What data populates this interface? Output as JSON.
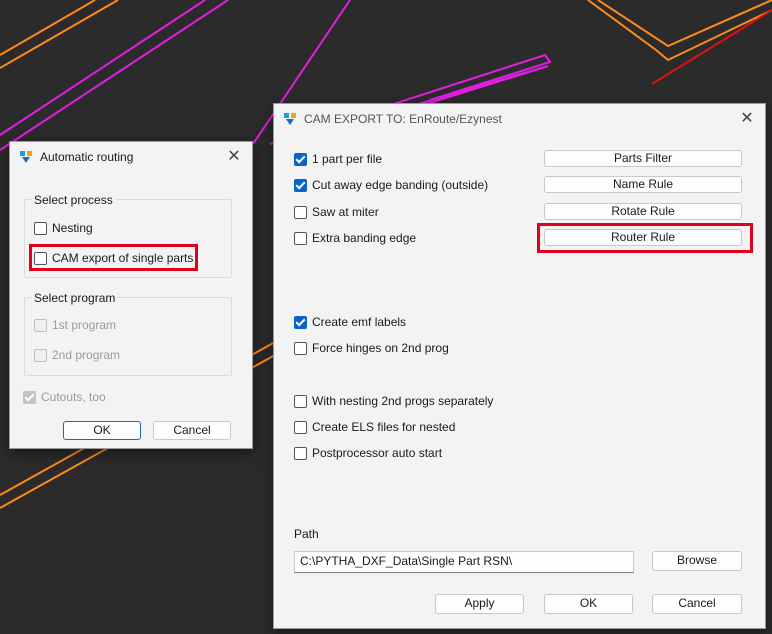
{
  "auto_routing": {
    "title": "Automatic routing",
    "select_process": {
      "label": "Select process",
      "options": [
        {
          "label": "Nesting",
          "checked": false
        },
        {
          "label": "CAM export of single parts",
          "checked": false
        }
      ]
    },
    "select_program": {
      "label": "Select program",
      "options": [
        {
          "label": "1st program",
          "checked": false
        },
        {
          "label": "2nd program",
          "checked": false
        }
      ]
    },
    "cutouts": {
      "label": "Cutouts, too",
      "checked": true
    },
    "ok_label": "OK",
    "cancel_label": "Cancel"
  },
  "cam_export": {
    "title": "CAM EXPORT TO: EnRoute/Ezynest",
    "options": [
      {
        "label": "1 part per file",
        "checked": true
      },
      {
        "label": "Cut away edge banding (outside)",
        "checked": true
      },
      {
        "label": "Saw at miter",
        "checked": false
      },
      {
        "label": "Extra banding edge",
        "checked": false
      },
      {
        "label": "Create emf labels",
        "checked": true
      },
      {
        "label": "Force hinges on 2nd prog",
        "checked": false
      },
      {
        "label": "With nesting 2nd progs separately",
        "checked": false
      },
      {
        "label": "Create ELS files for nested",
        "checked": false
      },
      {
        "label": "Postprocessor auto start",
        "checked": false
      }
    ],
    "rule_buttons": [
      "Parts Filter",
      "Name Rule",
      "Rotate Rule",
      "Router Rule"
    ],
    "path_label": "Path",
    "path_value": "C:\\PYTHA_DXF_Data\\Single Part RSN\\",
    "browse_label": "Browse",
    "apply_label": "Apply",
    "ok_label": "OK",
    "cancel_label": "Cancel"
  },
  "colors": {
    "highlight": "#e0001b",
    "accent": "#0a64c8",
    "canvas": "#2b2b2b",
    "line_orange": "#ff8c1a",
    "line_magenta": "#e020e0",
    "line_red": "#e01010"
  },
  "icons": {
    "app": "pytha-app-icon",
    "close": "close-icon"
  }
}
